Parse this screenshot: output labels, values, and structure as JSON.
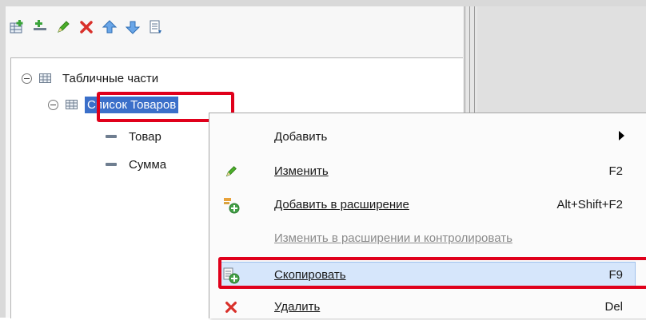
{
  "colors": {
    "selection": "#3b6fc9",
    "highlight_box": "#e0001b",
    "menu_hover": "#d6e6fb"
  },
  "toolbar": {
    "buttons": [
      {
        "name": "add-table-icon"
      },
      {
        "name": "add-attribute-icon"
      },
      {
        "name": "edit-pencil-icon"
      },
      {
        "name": "delete-icon"
      },
      {
        "name": "move-up-icon"
      },
      {
        "name": "move-down-icon"
      },
      {
        "name": "sort-list-icon"
      }
    ]
  },
  "tree": {
    "root_label": "Табличные части",
    "child_label": "Список Товаров",
    "leaves": [
      "Товар",
      "Сумма"
    ]
  },
  "context_menu": {
    "add": {
      "label": "Добавить"
    },
    "edit": {
      "label": "Изменить",
      "shortcut": "F2"
    },
    "add_to_extension": {
      "label": "Добавить в расширение",
      "shortcut": "Alt+Shift+F2"
    },
    "edit_in_extension": {
      "label": "Изменить в расширении и контролировать"
    },
    "copy": {
      "label": "Скопировать",
      "shortcut": "F9"
    },
    "delete": {
      "label": "Удалить",
      "shortcut": "Del"
    }
  }
}
